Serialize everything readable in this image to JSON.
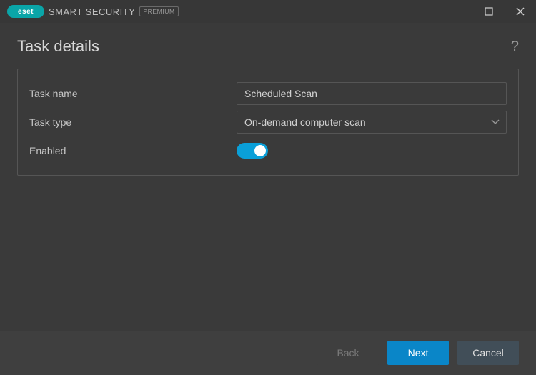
{
  "brand": {
    "logo_text": "eset",
    "name": "SMART SECURITY",
    "badge": "PREMIUM"
  },
  "page": {
    "title": "Task details"
  },
  "form": {
    "task_name_label": "Task name",
    "task_name_value": "Scheduled Scan",
    "task_type_label": "Task type",
    "task_type_value": "On-demand computer scan",
    "enabled_label": "Enabled",
    "enabled_value": true
  },
  "footer": {
    "back": "Back",
    "next": "Next",
    "cancel": "Cancel"
  },
  "colors": {
    "accent": "#0a9fd8",
    "primary_btn": "#0a86c8",
    "logo": "#0aa5a8"
  }
}
